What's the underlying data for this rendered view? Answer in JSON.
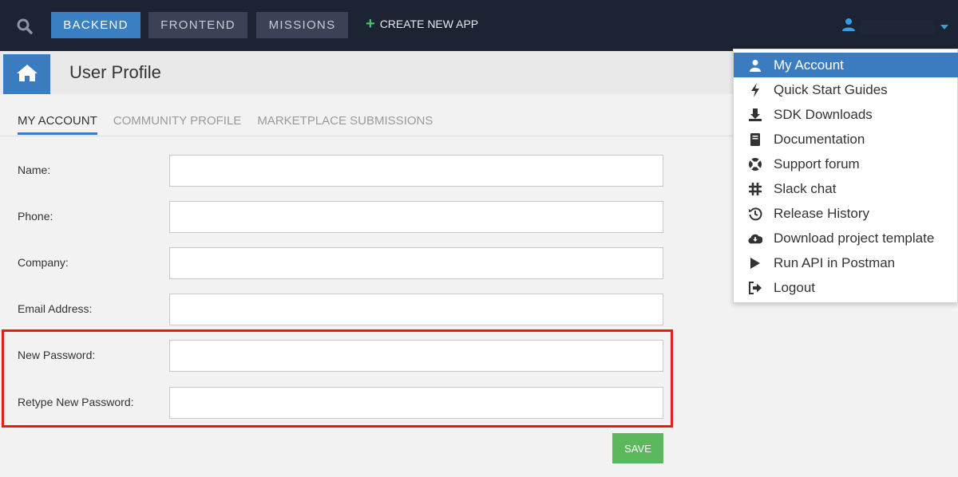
{
  "topbar": {
    "search_icon": "search-icon",
    "nav": [
      "BACKEND",
      "FRONTEND",
      "MISSIONS"
    ],
    "create_label": "CREATE NEW APP",
    "accent": "#3a7fc1"
  },
  "header": {
    "title": "User Profile"
  },
  "tabs": [
    "MY ACCOUNT",
    "COMMUNITY PROFILE",
    "MARKETPLACE SUBMISSIONS"
  ],
  "form": {
    "fields": [
      {
        "label": "Name:",
        "value": ""
      },
      {
        "label": "Phone:",
        "value": ""
      },
      {
        "label": "Company:",
        "value": ""
      },
      {
        "label": "Email Address:",
        "value": ""
      },
      {
        "label": "New Password:",
        "value": ""
      },
      {
        "label": "Retype New Password:",
        "value": ""
      }
    ],
    "save_label": "SAVE",
    "highlight_color": "#e51c1c"
  },
  "menu": [
    {
      "label": "My Account",
      "icon": "user-icon"
    },
    {
      "label": "Quick Start Guides",
      "icon": "bolt-icon"
    },
    {
      "label": "SDK Downloads",
      "icon": "download-icon"
    },
    {
      "label": "Documentation",
      "icon": "book-icon"
    },
    {
      "label": "Support forum",
      "icon": "lifebuoy-icon"
    },
    {
      "label": "Slack chat",
      "icon": "slack-icon"
    },
    {
      "label": "Release History",
      "icon": "history-icon"
    },
    {
      "label": "Download project template",
      "icon": "cloud-download-icon"
    },
    {
      "label": "Run API in Postman",
      "icon": "play-icon"
    },
    {
      "label": "Logout",
      "icon": "logout-icon"
    }
  ]
}
